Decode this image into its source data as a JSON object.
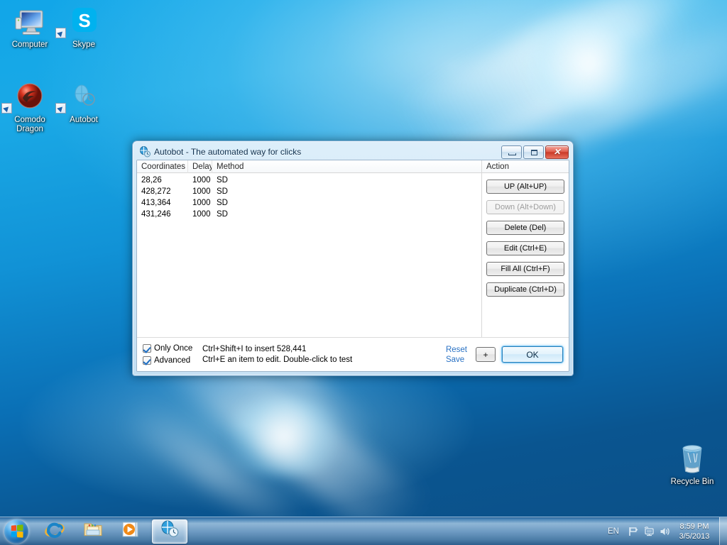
{
  "desktop": {
    "icons": [
      {
        "label": "Computer",
        "icon": "computer-icon",
        "shortcut": false
      },
      {
        "label": "Skype",
        "icon": "skype-icon",
        "shortcut": true
      },
      {
        "label": "Comodo\nDragon",
        "icon": "comodo-dragon-icon",
        "shortcut": true
      },
      {
        "label": "Autobot",
        "icon": "autobot-icon",
        "shortcut": true
      },
      {
        "label": "Recycle Bin",
        "icon": "recycle-bin-icon",
        "shortcut": false
      }
    ]
  },
  "taskbar": {
    "start_label": "Start",
    "buttons": [
      {
        "name": "internet-explorer",
        "label": "Internet Explorer",
        "active": false
      },
      {
        "name": "windows-explorer",
        "label": "Windows Explorer",
        "active": false
      },
      {
        "name": "media-player",
        "label": "Windows Media Player",
        "active": false
      },
      {
        "name": "autobot",
        "label": "Autobot",
        "active": true
      }
    ],
    "tray": {
      "language": "EN",
      "icons": [
        "flag-icon",
        "network-icon",
        "volume-icon"
      ],
      "time": "8:59 PM",
      "date": "3/5/2013"
    }
  },
  "window": {
    "title": "Autobot - The automated way for clicks",
    "icon": "mouse-icon",
    "controls": {
      "minimize": "Minimize",
      "maximize": "Maximize",
      "close": "Close"
    },
    "list": {
      "columns": [
        "Coordinates",
        "Delay",
        "Method"
      ],
      "rows": [
        {
          "coordinates": "28,26",
          "delay": "1000",
          "method": "SD"
        },
        {
          "coordinates": "428,272",
          "delay": "1000",
          "method": "SD"
        },
        {
          "coordinates": "413,364",
          "delay": "1000",
          "method": "SD"
        },
        {
          "coordinates": "431,246",
          "delay": "1000",
          "method": "SD"
        }
      ]
    },
    "action": {
      "header": "Action",
      "buttons": [
        {
          "label": "UP (Alt+UP)",
          "disabled": false
        },
        {
          "label": "Down (Alt+Down)",
          "disabled": true
        },
        {
          "label": "Delete (Del)",
          "disabled": false
        },
        {
          "label": "Edit (Ctrl+E)",
          "disabled": false
        },
        {
          "label": "Fill All (Ctrl+F)",
          "disabled": false
        },
        {
          "label": "Duplicate (Ctrl+D)",
          "disabled": false
        }
      ]
    },
    "bottom": {
      "only_once_label": "Only Once",
      "only_once_checked": true,
      "advanced_label": "Advanced",
      "advanced_checked": true,
      "hint_line1": "Ctrl+Shift+I to insert 528,441",
      "hint_line2": "Ctrl+E an item to edit. Double-click to test",
      "reset_label": "Reset",
      "save_label": "Save",
      "plus_label": "+",
      "ok_label": "OK"
    }
  },
  "colors": {
    "accent_blue": "#2a72c4",
    "desktop_blue": "#11a6e8",
    "close_red": "#ca3a28"
  }
}
